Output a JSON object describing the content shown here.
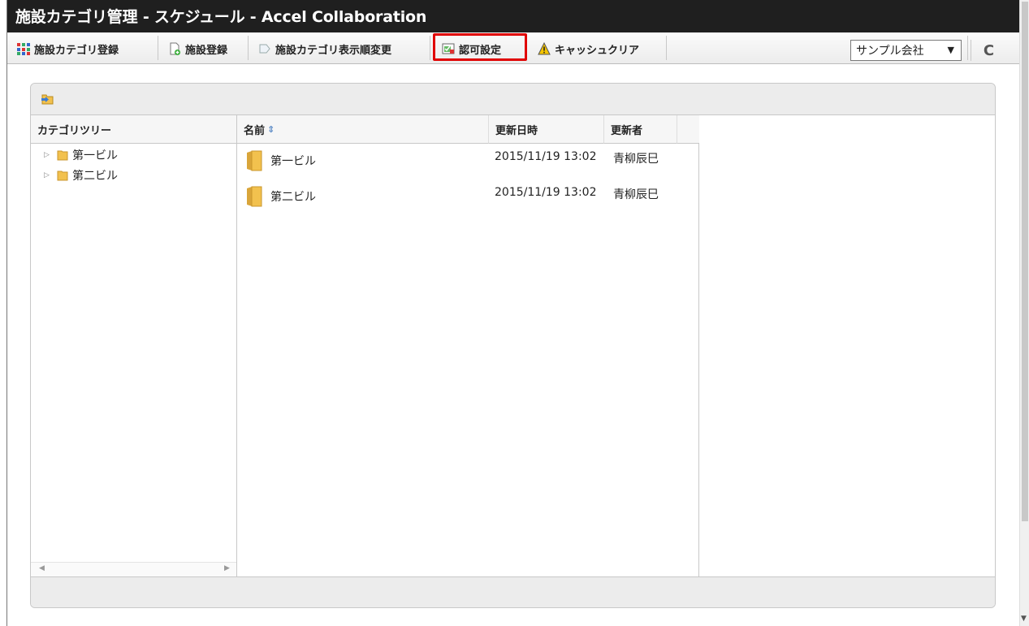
{
  "window": {
    "title": "施設カテゴリ管理 - スケジュール - Accel Collaboration"
  },
  "toolbar": {
    "buttons": [
      {
        "label": "施設カテゴリ登録",
        "icon": "category-grid-icon"
      },
      {
        "label": "施設登録",
        "icon": "add-document-icon"
      },
      {
        "label": "施設カテゴリ表示順変更",
        "icon": "sort-order-icon"
      },
      {
        "label": "認可設定",
        "icon": "authorization-icon"
      },
      {
        "label": "キャッシュクリア",
        "icon": "warning-icon"
      }
    ],
    "company_select": {
      "selected": "サンプル会社",
      "arrow": "▼"
    },
    "refresh_glyph": "C"
  },
  "tree": {
    "header": "カテゴリツリー",
    "items": [
      {
        "label": "第一ビル",
        "toggle": "▷"
      },
      {
        "label": "第二ビル",
        "toggle": "▷"
      }
    ],
    "scroll_left": "◀",
    "scroll_right": "▶"
  },
  "list": {
    "columns": {
      "name": "名前",
      "name_sort_glyph": "⇕",
      "updated_at": "更新日時",
      "updated_by": "更新者"
    },
    "rows": [
      {
        "name": "第一ビル",
        "updated_at": "2015/11/19 13:02",
        "updated_by": "青柳辰巳"
      },
      {
        "name": "第二ビル",
        "updated_at": "2015/11/19 13:02",
        "updated_by": "青柳辰巳"
      }
    ]
  },
  "colors": {
    "title_bar": "#1f1f1f",
    "highlight_border": "#e00000",
    "folder_yellow": "#f2c14e"
  }
}
